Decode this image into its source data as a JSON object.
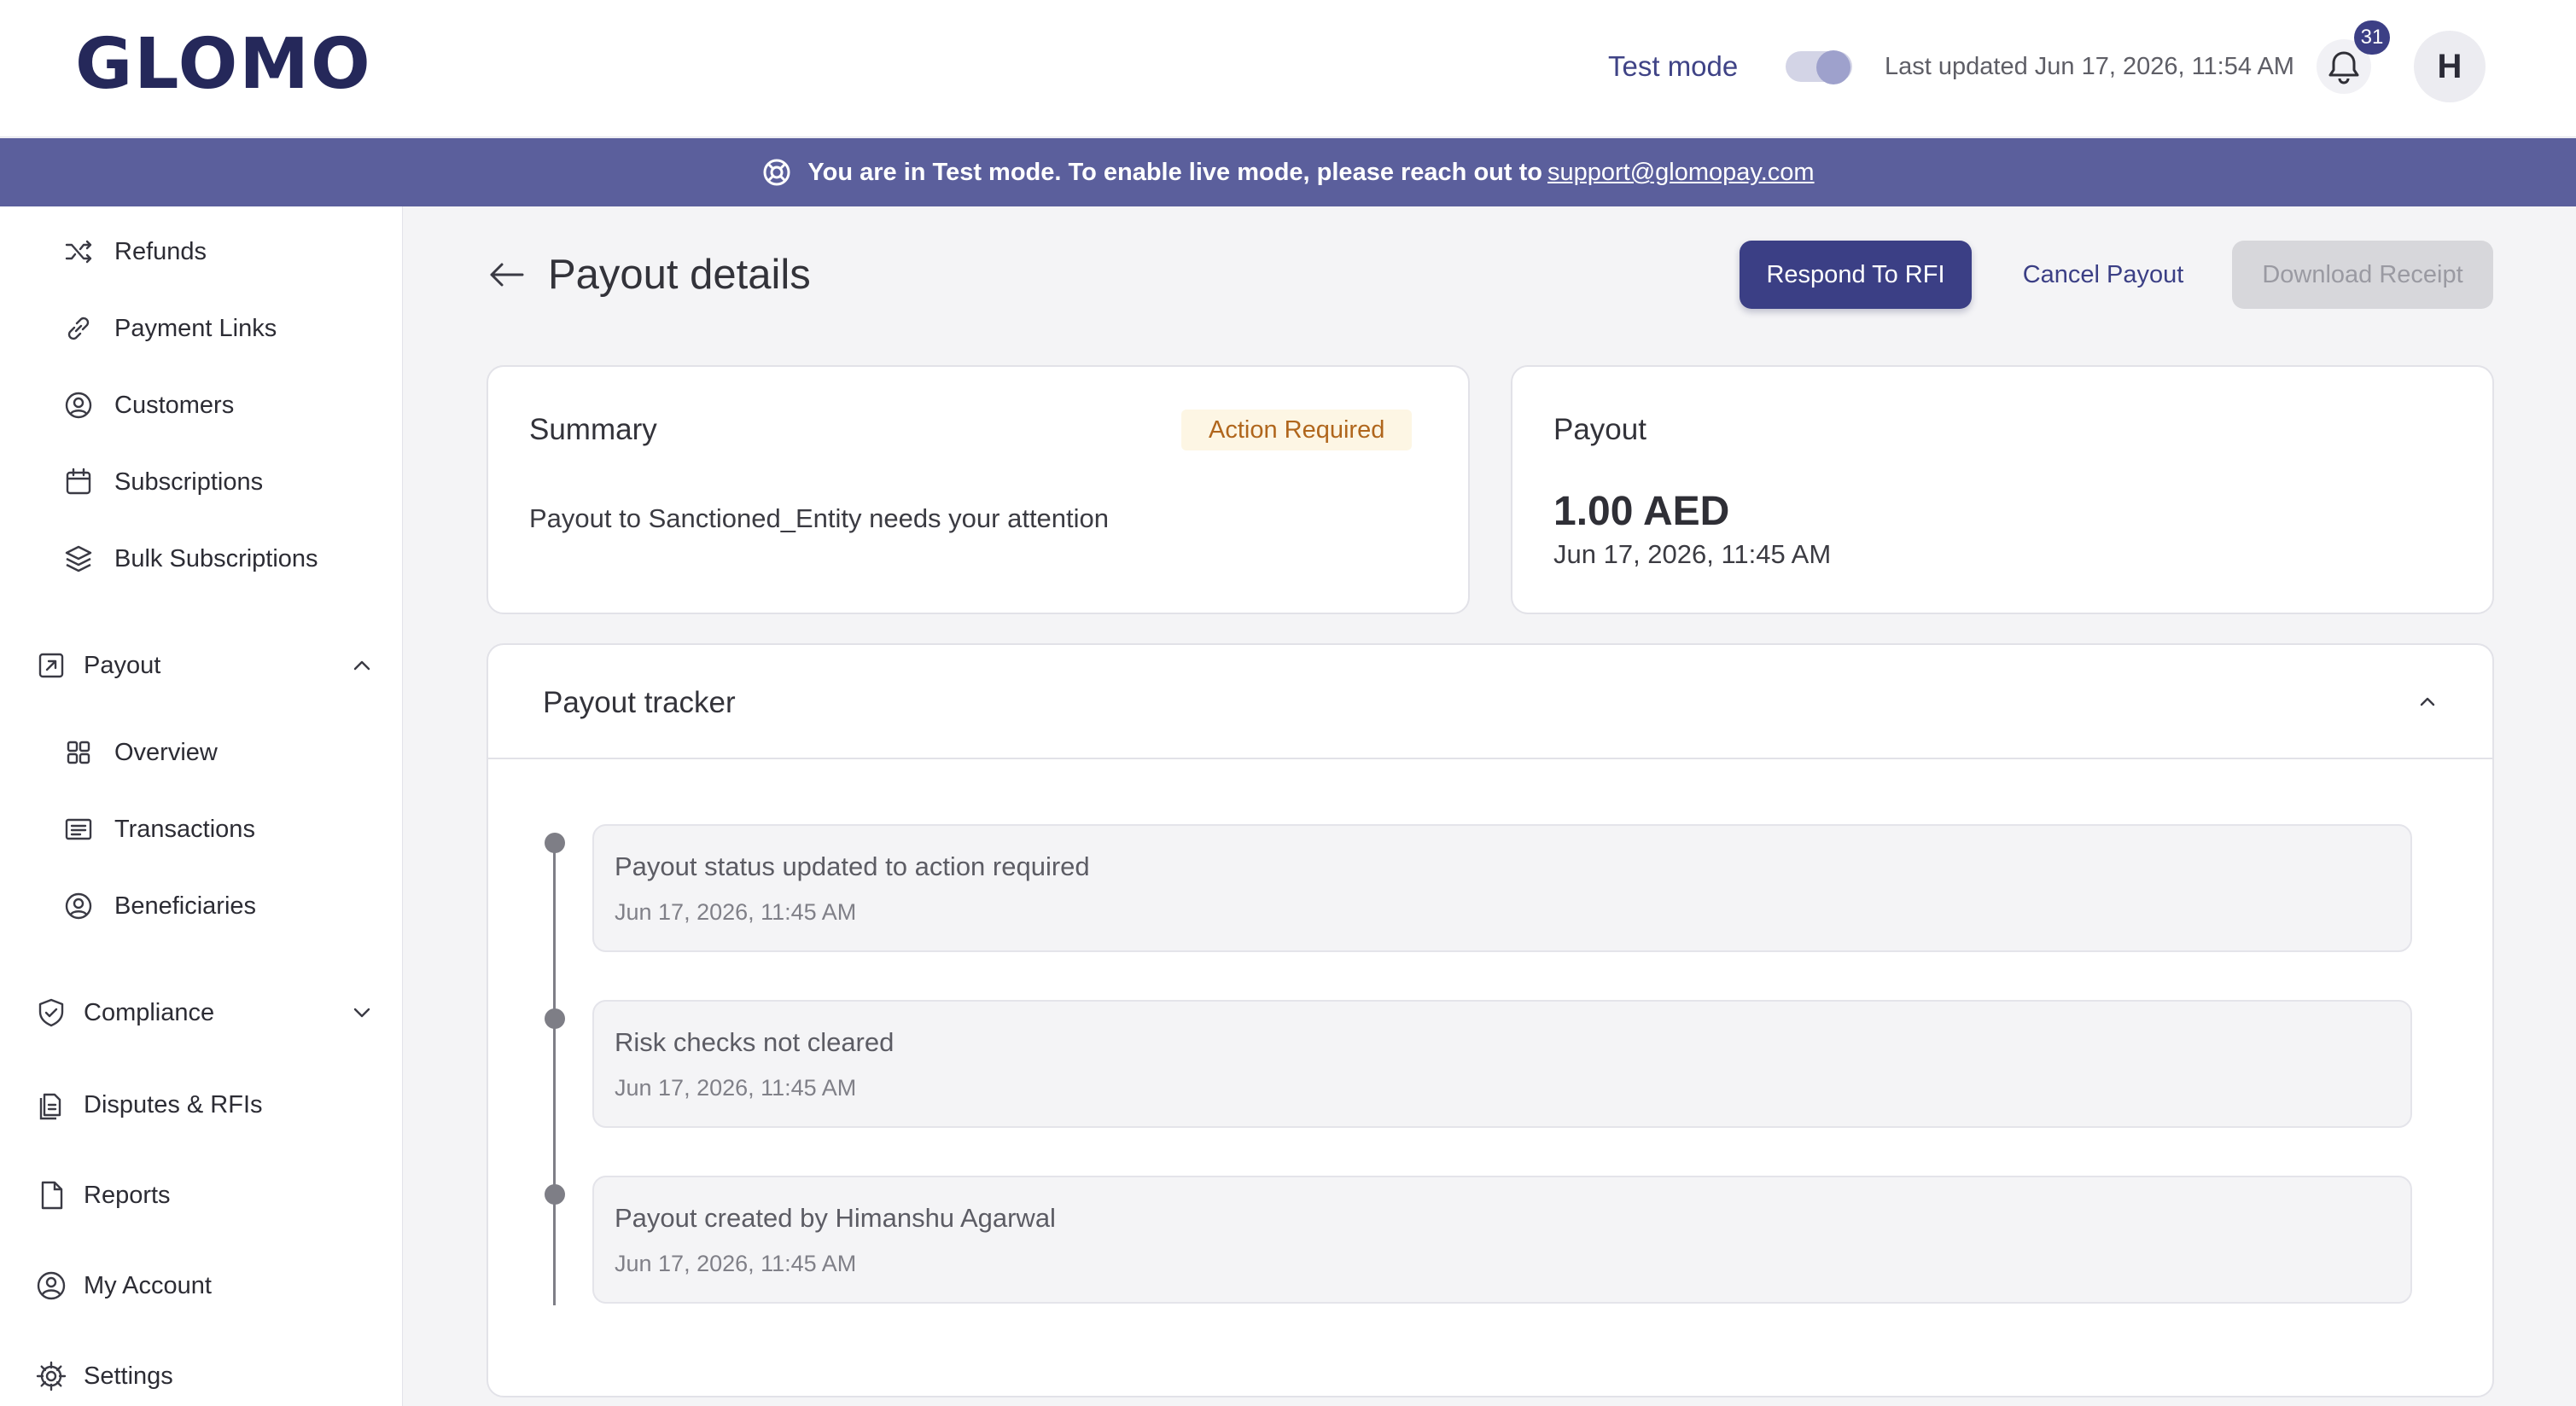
{
  "header": {
    "logo_text": "GLOMO",
    "test_mode_label": "Test mode",
    "test_mode_enabled": true,
    "last_updated": "Last updated Jun 17, 2026, 11:54 AM",
    "notifications_count": "31",
    "avatar_initial": "H"
  },
  "banner": {
    "text": "You are in Test mode. To enable live mode, please reach out to",
    "link_text": "support@glomopay.com",
    "icon": "lifebuoy-icon"
  },
  "sidebar": {
    "items": [
      {
        "label": "Refunds",
        "icon": "shuffle-icon"
      },
      {
        "label": "Payment Links",
        "icon": "link-icon"
      },
      {
        "label": "Customers",
        "icon": "customers-icon"
      },
      {
        "label": "Subscriptions",
        "icon": "calendar-icon"
      },
      {
        "label": "Bulk Subscriptions",
        "icon": "layers-icon"
      }
    ],
    "payout_section": {
      "label": "Payout",
      "icon": "payout-icon",
      "expanded": true,
      "children": [
        {
          "label": "Overview",
          "icon": "grid-icon"
        },
        {
          "label": "Transactions",
          "icon": "receipt-icon"
        },
        {
          "label": "Beneficiaries",
          "icon": "beneficiaries-icon"
        }
      ]
    },
    "compliance_section": {
      "label": "Compliance",
      "icon": "shield-check-icon",
      "expanded": false
    },
    "bottom_items": [
      {
        "label": "Disputes & RFIs",
        "icon": "documents-icon"
      },
      {
        "label": "Reports",
        "icon": "file-icon"
      },
      {
        "label": "My Account",
        "icon": "user-circle-icon"
      },
      {
        "label": "Settings",
        "icon": "gear-icon"
      }
    ]
  },
  "page": {
    "title": "Payout details",
    "actions": {
      "respond_rfi": "Respond To RFI",
      "cancel_payout": "Cancel Payout",
      "download_receipt": "Download Receipt"
    }
  },
  "summary": {
    "title": "Summary",
    "status": "Action Required",
    "message": "Payout to Sanctioned_Entity needs your attention"
  },
  "payout": {
    "title": "Payout",
    "amount": "1.00 AED",
    "date": "Jun 17, 2026, 11:45 AM"
  },
  "tracker": {
    "title": "Payout tracker",
    "expanded": true,
    "events": [
      {
        "title": "Payout status updated to action required",
        "time": "Jun 17, 2026, 11:45 AM"
      },
      {
        "title": "Risk checks not cleared",
        "time": "Jun 17, 2026, 11:45 AM"
      },
      {
        "title": "Payout created by Himanshu Agarwal",
        "time": "Jun 17, 2026, 11:45 AM"
      }
    ]
  },
  "colors": {
    "brand": "#25285a",
    "primary": "#3b3f85",
    "banner": "#5b5f9c",
    "warning_text": "#b0661c",
    "warning_bg": "#fdf6e4"
  }
}
